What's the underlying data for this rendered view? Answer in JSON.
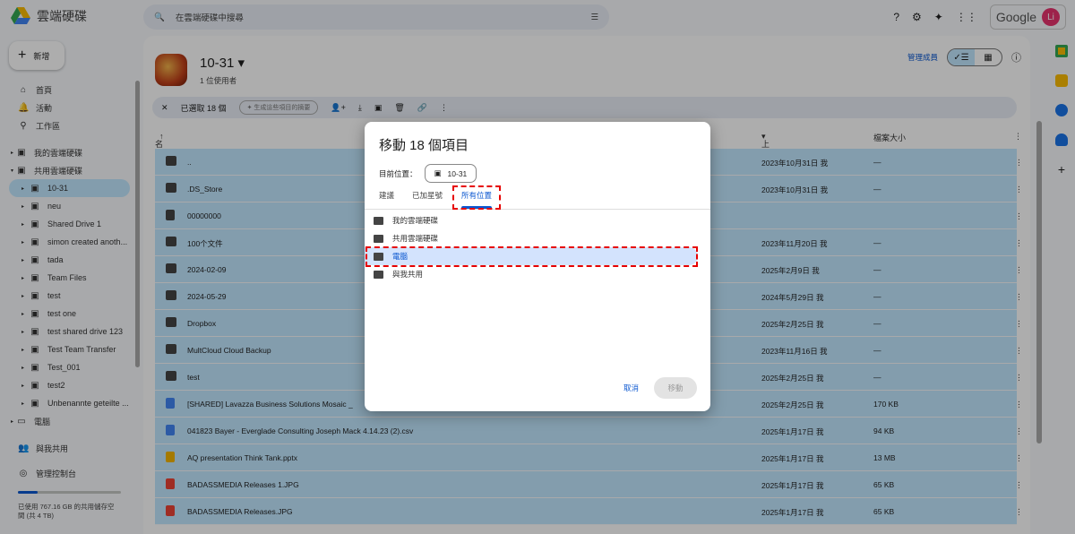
{
  "app": {
    "title": "雲端硬碟",
    "search_placeholder": "在雲端硬碟中搜尋",
    "google": "Google",
    "avatar": "Li"
  },
  "sidebar": {
    "new": "新增",
    "items": [
      {
        "label": "首頁",
        "icon": "home-icon",
        "glyph": "⌂"
      },
      {
        "label": "活動",
        "icon": "bell-icon",
        "glyph": "🔔"
      },
      {
        "label": "工作區",
        "icon": "workspace-icon",
        "glyph": "⚲"
      },
      {
        "label": "我的雲端硬碟",
        "icon": "my-drive-icon",
        "glyph": "▣"
      },
      {
        "label": "共用雲端硬碟",
        "icon": "shared-drive-icon",
        "glyph": "▣"
      }
    ],
    "shared_drives": [
      "10-31",
      "neu",
      "Shared Drive 1",
      "simon created anoth...",
      "tada",
      "Team Files",
      "test",
      "test one",
      "test shared drive 123",
      "Test Team Transfer",
      "Test_001",
      "test2",
      "Unbenannte geteilte ..."
    ],
    "bottom": [
      {
        "label": "電腦",
        "glyph": "▭"
      },
      {
        "label": "與我共用",
        "glyph": "👥"
      },
      {
        "label": "管理控制台",
        "glyph": "◎"
      }
    ],
    "storage": "已使用 767.16 GB 的共用儲存空間 (共 4 TB)",
    "storage_fraction": 0.19
  },
  "drive": {
    "title": "10-31",
    "members": "1 位使用者",
    "manage": "管理成員"
  },
  "selection": {
    "label": "已選取 18 個",
    "summary": "生成這些項目的摘要"
  },
  "columns": {
    "name": "名稱",
    "modified": "上次修改時間",
    "size": "檔案大小"
  },
  "files": [
    {
      "name": "..",
      "modified": "2023年10月31日 我",
      "size": "—",
      "type": "folder"
    },
    {
      "name": ".DS_Store",
      "modified": "2023年10月31日 我",
      "size": "—",
      "type": "folder"
    },
    {
      "name": "00000000",
      "modified": "",
      "size": "",
      "type": "shortcut"
    },
    {
      "name": "100个文件",
      "modified": "2023年11月20日 我",
      "size": "—",
      "type": "folder"
    },
    {
      "name": "2024-02-09",
      "modified": "2025年2月9日 我",
      "size": "—",
      "type": "folder"
    },
    {
      "name": "2024-05-29",
      "modified": "2024年5月29日 我",
      "size": "—",
      "type": "folder"
    },
    {
      "name": "Dropbox",
      "modified": "2025年2月25日 我",
      "size": "—",
      "type": "folder"
    },
    {
      "name": "MultCloud Cloud Backup",
      "modified": "2023年11月16日 我",
      "size": "—",
      "type": "folder"
    },
    {
      "name": "test",
      "modified": "2025年2月25日 我",
      "size": "—",
      "type": "folder"
    },
    {
      "name": "[SHARED] Lavazza Business Solutions Mosaic _",
      "modified": "2025年2月25日 我",
      "size": "170 KB",
      "type": "doc",
      "color": "#4285f4"
    },
    {
      "name": "041823 Bayer - Everglade Consulting  Joseph Mack  4.14.23 (2).csv",
      "modified": "2025年1月17日 我",
      "size": "94 KB",
      "type": "doc",
      "color": "#4285f4"
    },
    {
      "name": "AQ presentation Think Tank.pptx",
      "modified": "2025年1月17日 我",
      "size": "13 MB",
      "type": "slides",
      "color": "#f4b400"
    },
    {
      "name": "BADASSMEDIA Releases 1.JPG",
      "modified": "2025年1月17日 我",
      "size": "65 KB",
      "type": "image",
      "color": "#ea4335"
    },
    {
      "name": "BADASSMEDIA Releases.JPG",
      "modified": "2025年1月17日 我",
      "size": "65 KB",
      "type": "image",
      "color": "#ea4335"
    }
  ],
  "dialog": {
    "title": "移動 18 個項目",
    "current_label": "目前位置：",
    "current": "10-31",
    "tabs": [
      "建議",
      "已加星號",
      "所有位置"
    ],
    "options": [
      "我的雲端硬碟",
      "共用雲端硬碟",
      "電腦",
      "與我共用"
    ],
    "cancel": "取消",
    "move": "移動"
  }
}
